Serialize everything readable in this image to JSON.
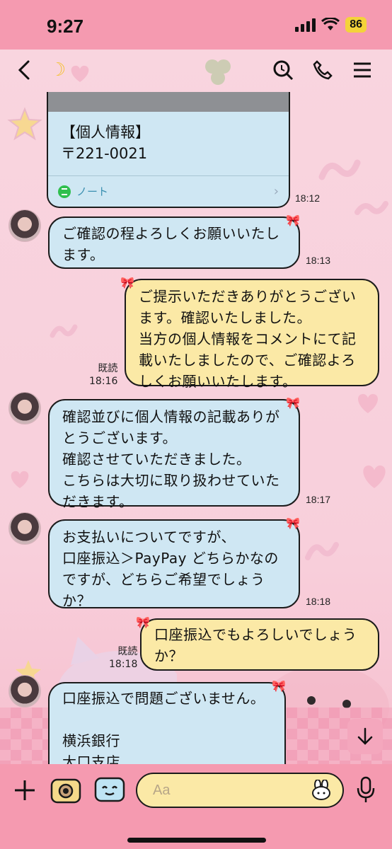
{
  "status": {
    "time": "9:27",
    "battery": "86"
  },
  "header": {
    "title_icon": "moon-avatar"
  },
  "note_card": {
    "title": "【個人情報】",
    "zip": "〒221-0021",
    "label": "ノート",
    "time": "18:12"
  },
  "messages": [
    {
      "side": "in",
      "lines": [
        "ご確認の程よろしくお願いいたし",
        "ます。"
      ],
      "time": "18:13"
    },
    {
      "side": "out",
      "lines": [
        "ご提示いただきありがとうござい",
        "ます。確認いたしました。",
        "当方の個人情報をコメントにて記",
        "載いたしましたので、ご確認よろ",
        "しくお願いいたします。"
      ],
      "read": "既読",
      "time": "18:16"
    },
    {
      "side": "in",
      "lines": [
        "確認並びに個人情報の記載ありが",
        "とうございます。",
        "確認させていただきました。",
        "こちらは大切に取り扱わせていた",
        "だきます。"
      ],
      "time": "18:17"
    },
    {
      "side": "in",
      "lines": [
        "お支払いについてですが、",
        "口座振込＞PayPay どちらかなの",
        "ですが、どちらご希望でしょう",
        "か？"
      ],
      "time": "18:18"
    },
    {
      "side": "out",
      "lines": [
        "口座振込でもよろしいでしょう",
        "か？"
      ],
      "read": "既読",
      "time": "18:18"
    },
    {
      "side": "in",
      "lines": [
        "口座振込で問題ございません。",
        "",
        "横浜銀行",
        "大口支店"
      ],
      "time": ""
    }
  ],
  "input": {
    "placeholder": "Aa"
  },
  "colors": {
    "header_pink": "#f59ab0",
    "incoming_bubble": "#cfe7f3",
    "outgoing_bubble": "#fbe9a6",
    "border": "#1b1b1b"
  }
}
